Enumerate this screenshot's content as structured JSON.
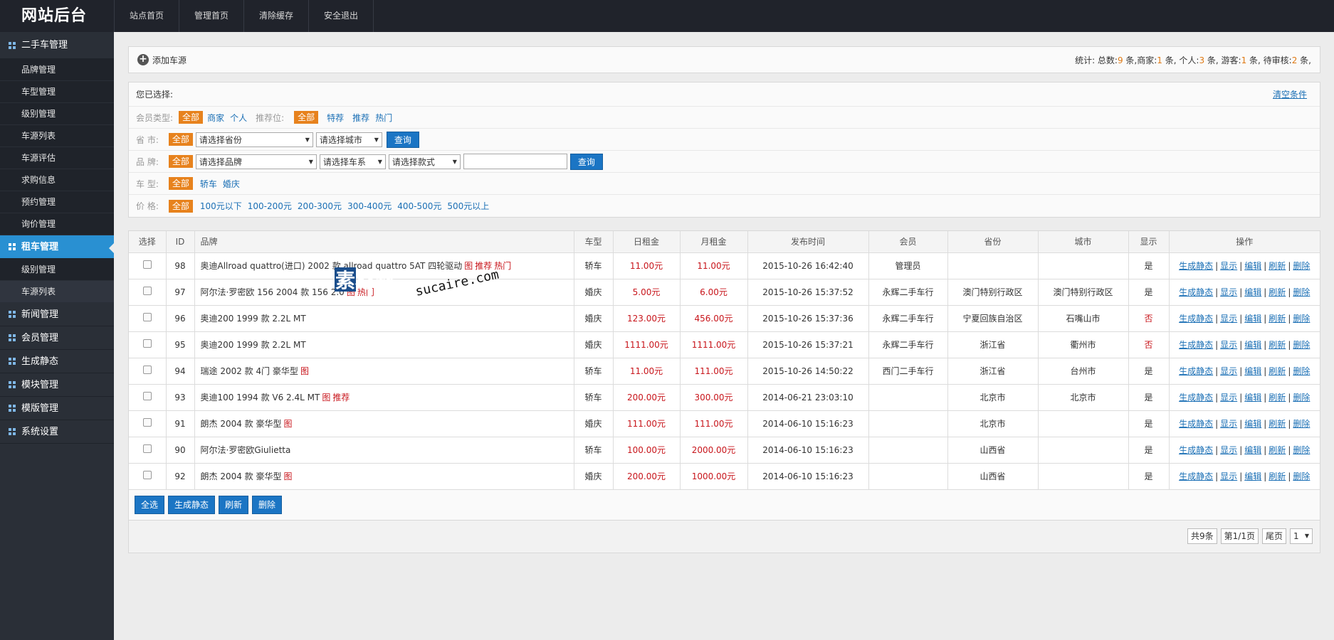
{
  "header": {
    "logo": "网站后台",
    "nav": [
      "站点首页",
      "管理首页",
      "清除缓存",
      "安全退出"
    ]
  },
  "sidebar": {
    "sections": [
      {
        "label": "二手车管理",
        "items": [
          "品牌管理",
          "车型管理",
          "级别管理",
          "车源列表",
          "车源评估",
          "求购信息",
          "预约管理",
          "询价管理"
        ]
      },
      {
        "label": "租车管理",
        "items": [
          "级别管理",
          "车源列表"
        ]
      },
      {
        "label": "新闻管理"
      },
      {
        "label": "会员管理"
      },
      {
        "label": "生成静态"
      },
      {
        "label": "模块管理"
      },
      {
        "label": "模版管理"
      },
      {
        "label": "系统设置"
      }
    ]
  },
  "toolbar": {
    "add_label": "添加车源",
    "stats": {
      "prefix": "统计: 总数:",
      "total": "9",
      "t1": " 条,商家:",
      "merchant": "1",
      "t2": " 条, 个人:",
      "personal": "3",
      "t3": " 条, 游客:",
      "guest": "1",
      "t4": " 条, 待审核:",
      "pending": "2",
      "t5": " 条,"
    }
  },
  "filter": {
    "selected_label": "您已选择:",
    "clear_label": "清空条件",
    "member_type_label": "会员类型:",
    "all": "全部",
    "member_types": [
      "商家",
      "个人"
    ],
    "recommend_label": "推荐位:",
    "recommend_opts": [
      "特荐",
      "推荐",
      "热门"
    ],
    "province_label": "省 市:",
    "province_placeholder": "请选择省份",
    "city_placeholder": "请选择城市",
    "query": "查询",
    "brand_label": "品 牌:",
    "brand_placeholder": "请选择品牌",
    "series_placeholder": "请选择车系",
    "style_placeholder": "请选择款式",
    "cartype_label": "车 型:",
    "cartypes": [
      "轿车",
      "婚庆"
    ],
    "price_label": "价 格:",
    "prices": [
      "100元以下",
      "100-200元",
      "200-300元",
      "300-400元",
      "400-500元",
      "500元以上"
    ]
  },
  "table": {
    "headers": [
      "选择",
      "ID",
      "品牌",
      "车型",
      "日租金",
      "月租金",
      "发布时间",
      "会员",
      "省份",
      "城市",
      "显示",
      "操作"
    ],
    "ops": [
      "生成静态",
      "显示",
      "编辑",
      "刷新",
      "删除"
    ],
    "rows": [
      {
        "id": "98",
        "brand": "奥迪Allroad quattro(进口) 2002 款 allroad quattro 5AT 四轮驱动",
        "marks": [
          "图",
          "推荐",
          "热门"
        ],
        "type": "轿车",
        "daily": "11.00元",
        "monthly": "11.00元",
        "time": "2015-10-26 16:42:40",
        "member": "管理员",
        "province": "",
        "city": "",
        "show": "是"
      },
      {
        "id": "97",
        "brand": "阿尔法·罗密欧 156 2004 款 156 2.0",
        "marks": [
          "图",
          "热门"
        ],
        "type": "婚庆",
        "daily": "5.00元",
        "monthly": "6.00元",
        "time": "2015-10-26 15:37:52",
        "member": "永辉二手车行",
        "province": "澳门特别行政区",
        "city": "澳门特别行政区",
        "show": "是"
      },
      {
        "id": "96",
        "brand": "奥迪200 1999 款 2.2L MT",
        "marks": [],
        "type": "婚庆",
        "daily": "123.00元",
        "monthly": "456.00元",
        "time": "2015-10-26 15:37:36",
        "member": "永辉二手车行",
        "province": "宁夏回族自治区",
        "city": "石嘴山市",
        "show": "否"
      },
      {
        "id": "95",
        "brand": "奥迪200 1999 款 2.2L MT",
        "marks": [],
        "type": "婚庆",
        "daily": "1111.00元",
        "monthly": "1111.00元",
        "time": "2015-10-26 15:37:21",
        "member": "永辉二手车行",
        "province": "浙江省",
        "city": "衢州市",
        "show": "否"
      },
      {
        "id": "94",
        "brand": "瑞途 2002 款 4门 豪华型",
        "marks": [
          "图"
        ],
        "type": "轿车",
        "daily": "11.00元",
        "monthly": "111.00元",
        "time": "2015-10-26 14:50:22",
        "member": "西门二手车行",
        "province": "浙江省",
        "city": "台州市",
        "show": "是"
      },
      {
        "id": "93",
        "brand": "奥迪100 1994 款 V6 2.4L MT",
        "marks": [
          "图",
          "推荐"
        ],
        "type": "轿车",
        "daily": "200.00元",
        "monthly": "300.00元",
        "time": "2014-06-21 23:03:10",
        "member": "",
        "province": "北京市",
        "city": "北京市",
        "show": "是"
      },
      {
        "id": "91",
        "brand": "朗杰 2004 款 豪华型",
        "marks": [
          "图"
        ],
        "type": "婚庆",
        "daily": "111.00元",
        "monthly": "111.00元",
        "time": "2014-06-10 15:16:23",
        "member": "",
        "province": "北京市",
        "city": "",
        "show": "是"
      },
      {
        "id": "90",
        "brand": "阿尔法·罗密欧Giulietta",
        "marks": [],
        "type": "轿车",
        "daily": "100.00元",
        "monthly": "2000.00元",
        "time": "2014-06-10 15:16:23",
        "member": "",
        "province": "山西省",
        "city": "",
        "show": "是"
      },
      {
        "id": "92",
        "brand": "朗杰 2004 款 豪华型",
        "marks": [
          "图"
        ],
        "type": "婚庆",
        "daily": "200.00元",
        "monthly": "1000.00元",
        "time": "2014-06-10 15:16:23",
        "member": "",
        "province": "山西省",
        "city": "",
        "show": "是"
      }
    ]
  },
  "bulk_actions": [
    "全选",
    "生成静态",
    "刷新",
    "删除"
  ],
  "pager": {
    "total": "共9条",
    "page": "第1/1页",
    "last": "尾页",
    "current": "1"
  },
  "watermark": {
    "cn": "素材熱",
    "en": "sucaire.com"
  },
  "colors": {
    "accent": "#2990d2",
    "tag": "#e7821d",
    "button": "#1b75c4",
    "red": "#c8151b",
    "sidebar": "#2a2f37",
    "topbar": "#20232b"
  }
}
